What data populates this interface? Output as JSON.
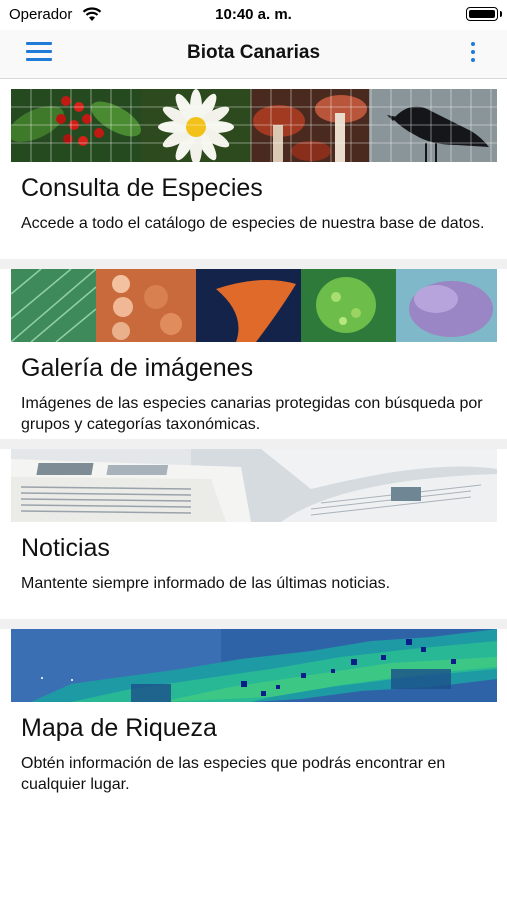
{
  "status": {
    "carrier": "Operador",
    "time": "10:40 a. m."
  },
  "navbar": {
    "title": "Biota Canarias",
    "menu_icon": "hamburger-menu-icon",
    "more_icon": "more-vertical-icon"
  },
  "cards": [
    {
      "title": "Consulta de Especies",
      "description": "Accede a todo el catálogo de especies de nuestra base de datos.",
      "image": "species-collage"
    },
    {
      "title": "Galería de imágenes",
      "description": "Imágenes de las especies canarias protegidas con búsqueda por grupos y categorías taxonómicas.",
      "image": "gallery-collage"
    },
    {
      "title": "Noticias",
      "description": "Mantente siempre informado de las últimas noticias.",
      "image": "newspapers"
    },
    {
      "title": "Mapa de Riqueza",
      "description": "Obtén información de las especies que podrás encontrar en cualquier lugar.",
      "image": "richness-map"
    }
  ],
  "colors": {
    "accent": "#1e7bd6",
    "separator": "#f0f0f0"
  }
}
